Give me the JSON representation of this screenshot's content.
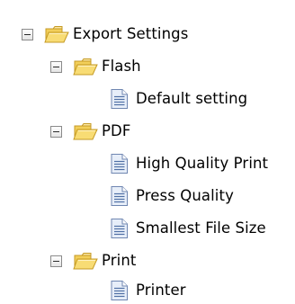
{
  "tree": {
    "nodes": [
      {
        "label": "Export Settings",
        "kind": "folder",
        "expanded": true
      },
      {
        "label": "Flash",
        "kind": "folder",
        "expanded": true
      },
      {
        "label": "Default setting",
        "kind": "item"
      },
      {
        "label": "PDF",
        "kind": "folder",
        "expanded": true
      },
      {
        "label": "High Quality Print",
        "kind": "item"
      },
      {
        "label": "Press Quality",
        "kind": "item"
      },
      {
        "label": "Smallest File Size",
        "kind": "item"
      },
      {
        "label": "Print",
        "kind": "folder",
        "expanded": true
      },
      {
        "label": "Printer",
        "kind": "item"
      }
    ]
  },
  "icons": {
    "folder": "folder-open-icon",
    "item": "document-icon",
    "toggle": "collapse-minus-icon"
  },
  "colors": {
    "folder_fill": "#f7d667",
    "folder_stroke": "#c59a24",
    "page_fill": "#e7eef9",
    "page_stroke": "#6f86b1"
  }
}
